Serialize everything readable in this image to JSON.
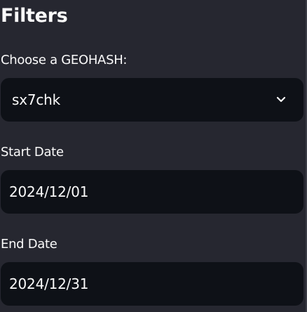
{
  "sidebar": {
    "title": "Filters",
    "geohash": {
      "label": "Choose a GEOHASH:",
      "selected": "sx7chk",
      "icon": "chevron-down-icon"
    },
    "start_date": {
      "label": "Start Date",
      "value": "2024/12/01"
    },
    "end_date": {
      "label": "End Date",
      "value": "2024/12/31"
    }
  },
  "colors": {
    "sidebar_background": "#262730",
    "input_background": "#0e1117",
    "text": "#fafafa"
  }
}
